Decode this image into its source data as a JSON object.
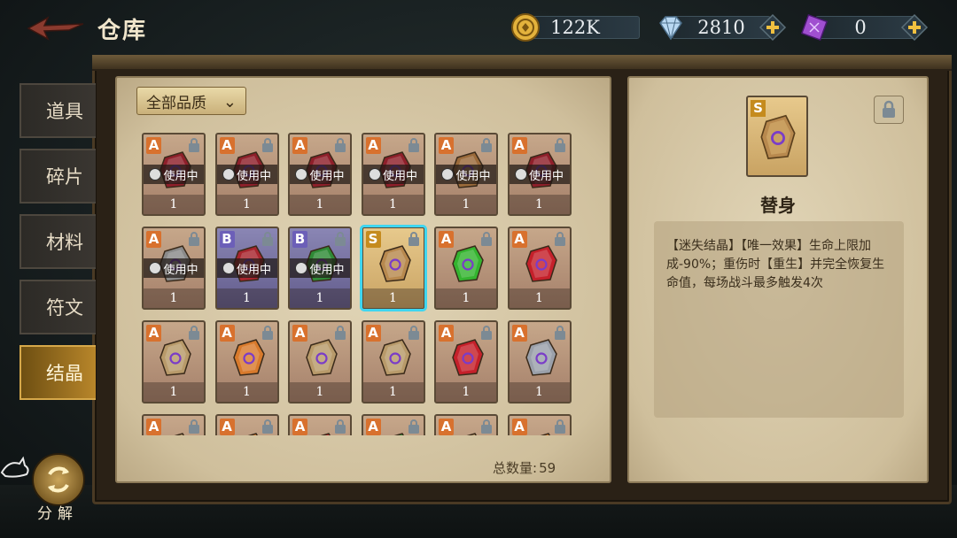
{
  "header": {
    "title": "仓库",
    "currencies": [
      {
        "name": "gold",
        "value": "122K",
        "has_plus": false
      },
      {
        "name": "diamond",
        "value": "2810",
        "has_plus": true
      },
      {
        "name": "crystal",
        "value": "0",
        "has_plus": true
      }
    ]
  },
  "tabs": [
    {
      "label": "道具",
      "active": false
    },
    {
      "label": "碎片",
      "active": false
    },
    {
      "label": "材料",
      "active": false
    },
    {
      "label": "符文",
      "active": false
    },
    {
      "label": "结晶",
      "active": true
    }
  ],
  "filter": {
    "label": "全部品质"
  },
  "inventory": {
    "total_label": "总数量:",
    "total_value": "59",
    "in_use_label": "使用中",
    "items": [
      {
        "grade": "A",
        "gem_color": "#8e1f2a",
        "in_use": true,
        "count": "1"
      },
      {
        "grade": "A",
        "gem_color": "#8e1f2a",
        "in_use": true,
        "count": "1"
      },
      {
        "grade": "A",
        "gem_color": "#8e1f2a",
        "in_use": true,
        "count": "1"
      },
      {
        "grade": "A",
        "gem_color": "#8e1f2a",
        "in_use": true,
        "count": "1"
      },
      {
        "grade": "A",
        "gem_color": "#9a6a3a",
        "in_use": true,
        "count": "1"
      },
      {
        "grade": "A",
        "gem_color": "#8e1f2a",
        "in_use": true,
        "count": "1"
      },
      {
        "grade": "A",
        "gem_color": "#8a8a8a",
        "in_use": true,
        "count": "1"
      },
      {
        "grade": "B",
        "gem_color": "#a8252e",
        "in_use": true,
        "count": "1"
      },
      {
        "grade": "B",
        "gem_color": "#2f8a36",
        "in_use": true,
        "count": "1"
      },
      {
        "grade": "S",
        "gem_color": "#b8894e",
        "in_use": false,
        "count": "1",
        "selected": true
      },
      {
        "grade": "A",
        "gem_color": "#34b42f",
        "in_use": false,
        "count": "1"
      },
      {
        "grade": "A",
        "gem_color": "#c5202a",
        "in_use": false,
        "count": "1"
      },
      {
        "grade": "A",
        "gem_color": "#b89a6a",
        "in_use": false,
        "count": "1"
      },
      {
        "grade": "A",
        "gem_color": "#d87a2c",
        "in_use": false,
        "count": "1"
      },
      {
        "grade": "A",
        "gem_color": "#b89a6a",
        "in_use": false,
        "count": "1"
      },
      {
        "grade": "A",
        "gem_color": "#b89a6a",
        "in_use": false,
        "count": "1"
      },
      {
        "grade": "A",
        "gem_color": "#c5202a",
        "in_use": false,
        "count": "1"
      },
      {
        "grade": "A",
        "gem_color": "#9aa0aa",
        "in_use": false,
        "count": "1"
      },
      {
        "grade": "A",
        "gem_color": "#b89a6a",
        "in_use": false,
        "count": ""
      },
      {
        "grade": "A",
        "gem_color": "#d87a2c",
        "in_use": false,
        "count": ""
      },
      {
        "grade": "A",
        "gem_color": "#c5202a",
        "in_use": false,
        "count": ""
      },
      {
        "grade": "A",
        "gem_color": "#2f8a36",
        "in_use": false,
        "count": ""
      },
      {
        "grade": "A",
        "gem_color": "#b89a6a",
        "in_use": false,
        "count": ""
      },
      {
        "grade": "A",
        "gem_color": "#d87a2c",
        "in_use": false,
        "count": ""
      }
    ]
  },
  "detail": {
    "grade": "S",
    "name": "替身",
    "description": "【迷失结晶】【唯一效果】生命上限加成-90%；重伤时【重生】并完全恢复生命值，每场战斗最多触发4次"
  },
  "decompose": {
    "label": "分解"
  },
  "colors": {
    "accent": "#3fd6f0",
    "tab_active": "#b8862a",
    "grade_A": "#d8712e",
    "grade_B": "#6c5fb8",
    "grade_S": "#c58b1e"
  }
}
